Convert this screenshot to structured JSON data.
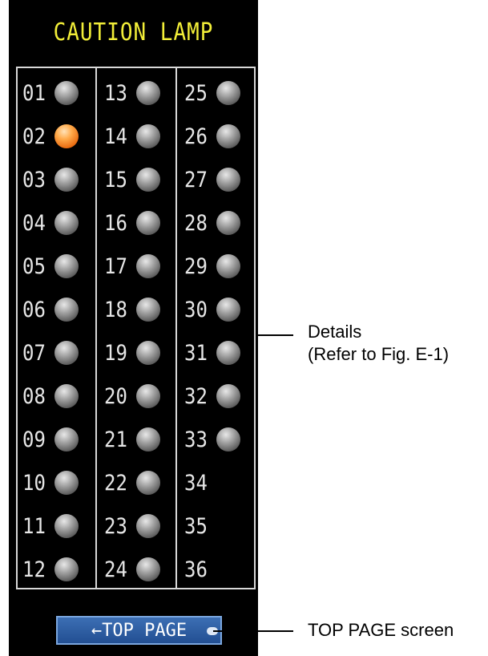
{
  "panel": {
    "title": "CAUTION LAMP",
    "columns": [
      {
        "lamps": [
          {
            "label": "01",
            "state": "off"
          },
          {
            "label": "02",
            "state": "on"
          },
          {
            "label": "03",
            "state": "off"
          },
          {
            "label": "04",
            "state": "off"
          },
          {
            "label": "05",
            "state": "off"
          },
          {
            "label": "06",
            "state": "off"
          },
          {
            "label": "07",
            "state": "off"
          },
          {
            "label": "08",
            "state": "off"
          },
          {
            "label": "09",
            "state": "off"
          },
          {
            "label": "10",
            "state": "off"
          },
          {
            "label": "11",
            "state": "off"
          },
          {
            "label": "12",
            "state": "off"
          }
        ]
      },
      {
        "lamps": [
          {
            "label": "13",
            "state": "off"
          },
          {
            "label": "14",
            "state": "off"
          },
          {
            "label": "15",
            "state": "off"
          },
          {
            "label": "16",
            "state": "off"
          },
          {
            "label": "17",
            "state": "off"
          },
          {
            "label": "18",
            "state": "off"
          },
          {
            "label": "19",
            "state": "off"
          },
          {
            "label": "20",
            "state": "off"
          },
          {
            "label": "21",
            "state": "off"
          },
          {
            "label": "22",
            "state": "off"
          },
          {
            "label": "23",
            "state": "off"
          },
          {
            "label": "24",
            "state": "off"
          }
        ]
      },
      {
        "lamps": [
          {
            "label": "25",
            "state": "off"
          },
          {
            "label": "26",
            "state": "off"
          },
          {
            "label": "27",
            "state": "off"
          },
          {
            "label": "28",
            "state": "off"
          },
          {
            "label": "29",
            "state": "off"
          },
          {
            "label": "30",
            "state": "off"
          },
          {
            "label": "31",
            "state": "off"
          },
          {
            "label": "32",
            "state": "off"
          },
          {
            "label": "33",
            "state": "off"
          },
          {
            "label": "34",
            "state": "none"
          },
          {
            "label": "35",
            "state": "none"
          },
          {
            "label": "36",
            "state": "none"
          }
        ]
      }
    ],
    "top_button_label": "←TOP PAGE"
  },
  "callouts": {
    "details_line1": "Details",
    "details_line2": "(Refer to Fig. E-1)",
    "top_page": "TOP PAGE screen"
  },
  "colors": {
    "panel_bg": "#000000",
    "title": "#f2ee38",
    "lamp_on": "#ff9a30",
    "lamp_off": "#8a8a8a",
    "button_bg": "#2c5ea3"
  }
}
